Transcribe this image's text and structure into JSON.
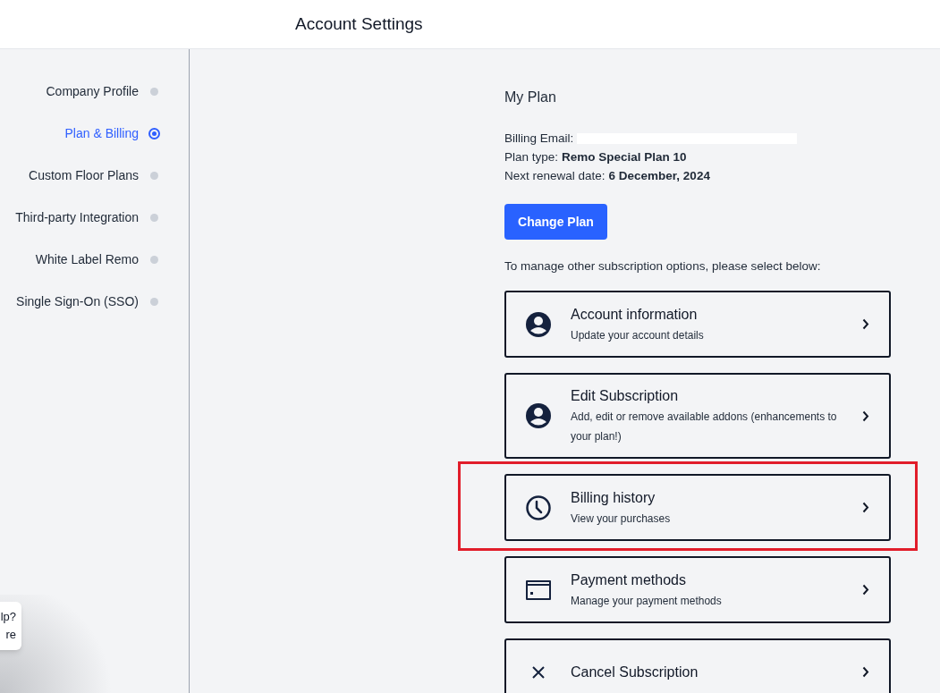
{
  "header": {
    "title": "Account Settings"
  },
  "sidebar": {
    "items": [
      {
        "label": "Company Profile",
        "selected": false
      },
      {
        "label": "Plan & Billing",
        "selected": true
      },
      {
        "label": "Custom Floor Plans",
        "selected": false
      },
      {
        "label": "Third-party Integration",
        "selected": false
      },
      {
        "label": "White Label Remo",
        "selected": false
      },
      {
        "label": "Single Sign-On (SSO)",
        "selected": false
      }
    ]
  },
  "plan": {
    "heading": "My Plan",
    "details": [
      {
        "label": "Billing Email:",
        "redacted": true
      },
      {
        "label": "Plan type:",
        "value": "Remo Special Plan 10"
      },
      {
        "label": "Next renewal date:",
        "value": "6 December, 2024"
      }
    ],
    "button": "Change Plan",
    "prompt": "To manage other subscription options, please select below:"
  },
  "options": [
    {
      "kind": "person",
      "title": "Account information",
      "subtitle": "Update your account details",
      "highlighted": false
    },
    {
      "kind": "person",
      "title": "Edit Subscription",
      "subtitle": "Add, edit or remove available addons (enhancements to your plan!)",
      "highlighted": false
    },
    {
      "kind": "clock",
      "title": "Billing history",
      "subtitle": "View your purchases",
      "highlighted": true
    },
    {
      "kind": "card",
      "title": "Payment methods",
      "subtitle": "Manage your payment methods",
      "highlighted": false
    },
    {
      "kind": "close",
      "title": "Cancel Subscription",
      "highlighted": false
    }
  ],
  "help_widget": {
    "lines": [
      "lp?",
      "re"
    ]
  }
}
